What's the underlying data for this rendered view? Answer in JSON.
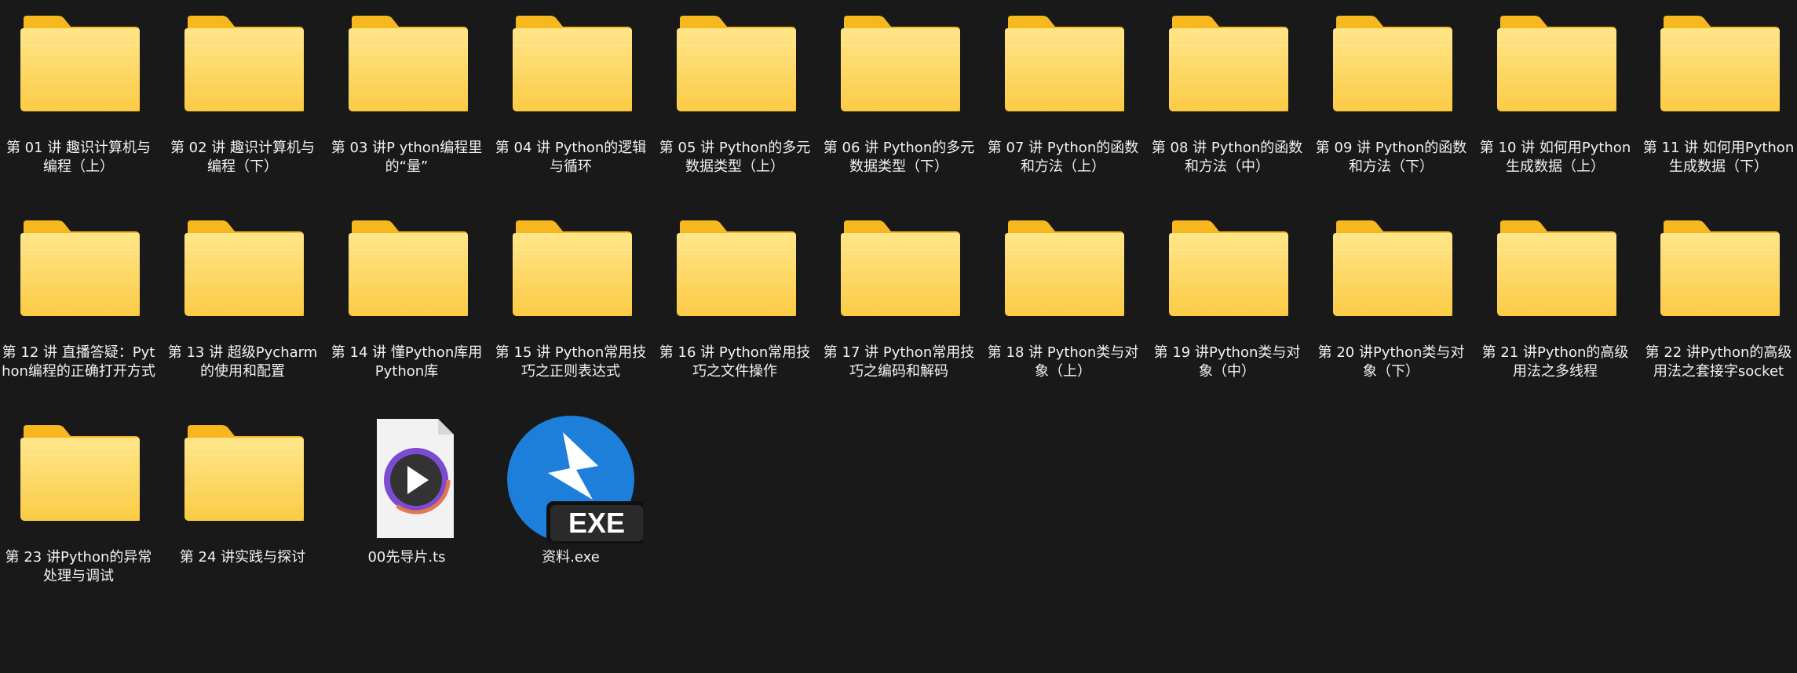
{
  "window": {
    "background": "#191919"
  },
  "colors": {
    "folder_back": "#F6B71F",
    "folder_front_top": "#FFE68A",
    "folder_front_bottom": "#FBCB45",
    "exe_blue": "#1E7FDB",
    "label_text": "#F2F2F2"
  },
  "items": [
    {
      "name": "第 01 讲 趣识计算机与编程（上）",
      "type": "folder-preview",
      "icon": "folder-icon"
    },
    {
      "name": "第 02 讲 趣识计算机与编程（下）",
      "type": "folder-preview",
      "icon": "folder-icon"
    },
    {
      "name": "第 03 讲P ython编程里的“量”",
      "type": "folder-preview",
      "icon": "folder-icon"
    },
    {
      "name": "第 04 讲 Python的逻辑与循环",
      "type": "folder",
      "icon": "folder-icon"
    },
    {
      "name": "第 05 讲 Python的多元数据类型（上）",
      "type": "folder",
      "icon": "folder-icon"
    },
    {
      "name": "第 06 讲 Python的多元数据类型（下）",
      "type": "folder",
      "icon": "folder-icon"
    },
    {
      "name": "第 07 讲 Python的函数和方法（上）",
      "type": "folder",
      "icon": "folder-icon"
    },
    {
      "name": "第 08 讲 Python的函数和方法（中）",
      "type": "folder",
      "icon": "folder-icon"
    },
    {
      "name": "第 09 讲 Python的函数和方法（下）",
      "type": "folder",
      "icon": "folder-icon"
    },
    {
      "name": "第 10 讲 如何用Python生成数据（上）",
      "type": "folder",
      "icon": "folder-icon"
    },
    {
      "name": "第 11 讲 如何用Python生成数据（下）",
      "type": "folder",
      "icon": "folder-icon"
    },
    {
      "name": "第 12 讲 直播答疑：Python编程的正确打开方式",
      "type": "folder",
      "icon": "folder-icon"
    },
    {
      "name": "第 13 讲 超级Pycharm的使用和配置",
      "type": "folder",
      "icon": "folder-icon"
    },
    {
      "name": "第 14 讲 懂Python库用Python库",
      "type": "folder",
      "icon": "folder-icon"
    },
    {
      "name": "第 15 讲 Python常用技巧之正则表达式",
      "type": "folder",
      "icon": "folder-icon"
    },
    {
      "name": "第 16 讲 Python常用技巧之文件操作",
      "type": "folder",
      "icon": "folder-icon"
    },
    {
      "name": "第 17 讲 Python常用技巧之编码和解码",
      "type": "folder",
      "icon": "folder-icon"
    },
    {
      "name": "第 18 讲 Python类与对象（上）",
      "type": "folder",
      "icon": "folder-icon"
    },
    {
      "name": "第 19 讲Python类与对象（中）",
      "type": "folder",
      "icon": "folder-icon"
    },
    {
      "name": "第 20 讲Python类与对象（下）",
      "type": "folder",
      "icon": "folder-icon"
    },
    {
      "name": "第 21 讲Python的高级用法之多线程",
      "type": "folder",
      "icon": "folder-icon"
    },
    {
      "name": "第 22 讲Python的高级用法之套接字socket",
      "type": "folder",
      "icon": "folder-icon"
    },
    {
      "name": "第 23 讲Python的异常处理与调试",
      "type": "folder",
      "icon": "folder-icon"
    },
    {
      "name": "第 24 讲实践与探讨",
      "type": "folder",
      "icon": "folder-icon"
    },
    {
      "name": "00先导片.ts",
      "type": "video",
      "icon": "video-file-icon"
    },
    {
      "name": "资料.exe",
      "type": "exe",
      "icon": "exe-icon",
      "badge": "EXE"
    }
  ]
}
